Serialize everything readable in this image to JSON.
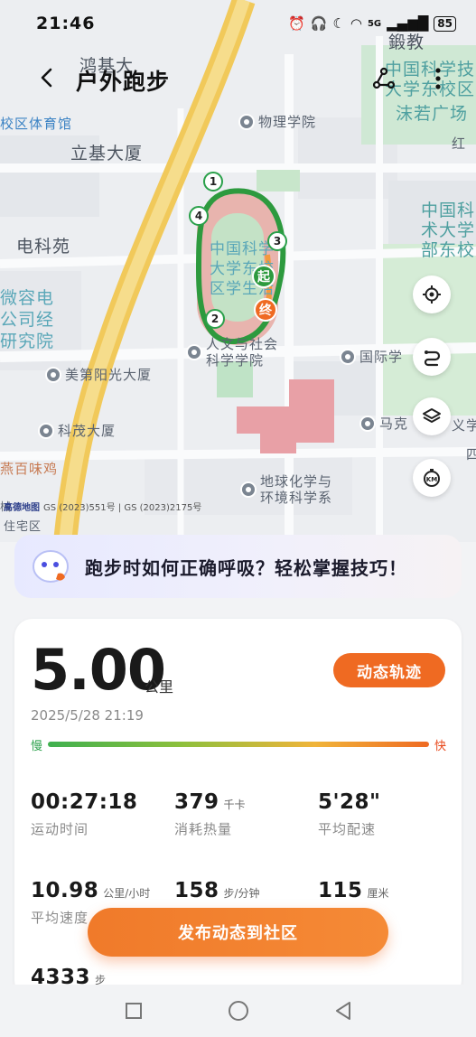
{
  "status_bar": {
    "time": "21:46",
    "battery": "85",
    "signal_label": "5G"
  },
  "header": {
    "title": "户外跑步"
  },
  "map": {
    "labels": {
      "top_partial": "鸿基大",
      "top_right_1": "鍛教",
      "ustc_east": "中国科学技\n大学东校区",
      "moruo": "沫若广场",
      "red_partial": "红",
      "stadium": "校区体育馆",
      "physics": "物理学院",
      "liji": "立基大厦",
      "ustc_right": "中国科\n术大学\n部东校",
      "dianke": "电科苑",
      "weiyi": "微容电\n公司经\n研究院",
      "campus": "中国科学\n大学东校\n区学生活",
      "humanities": "人文与社会\n科学学院",
      "meidi": "美第阳光大厦",
      "international": "国际学",
      "kemao": "科茂大厦",
      "marx": "马克",
      "marx_right": "义学",
      "yanyan": "燕百味鸡",
      "geochem": "地球化学与\n环境科学系",
      "xie": "械",
      "zhuzhaiqu": "住宅区",
      "partial_4": "四"
    },
    "copyright_brand": "高德地图",
    "copyright_text": "GS (2023)551号 | GS (2023)2175号",
    "km_markers": [
      "1",
      "2",
      "3",
      "4"
    ],
    "start_marker": "起",
    "end_marker": "终"
  },
  "tip": {
    "text": "跑步时如何正确呼吸？轻松掌握技巧！"
  },
  "summary": {
    "distance": "5.00",
    "distance_unit": "公里",
    "dynamic_button": "动态轨迹",
    "date": "2025/5/28 21:19",
    "pace_slow": "慢",
    "pace_fast": "快",
    "stats": [
      {
        "value": "00:27:18",
        "unit": "",
        "label": "运动时间"
      },
      {
        "value": "379",
        "unit": "千卡",
        "label": "消耗热量"
      },
      {
        "value": "5'28\"",
        "unit": "",
        "label": "平均配速"
      },
      {
        "value": "10.98",
        "unit": "公里/小时",
        "label": "平均速度"
      },
      {
        "value": "158",
        "unit": "步/分钟",
        "label": ""
      },
      {
        "value": "115",
        "unit": "厘米",
        "label": ""
      },
      {
        "value": "4333",
        "unit": "步",
        "label": ""
      }
    ]
  },
  "publish_button": "发布动态到社区"
}
